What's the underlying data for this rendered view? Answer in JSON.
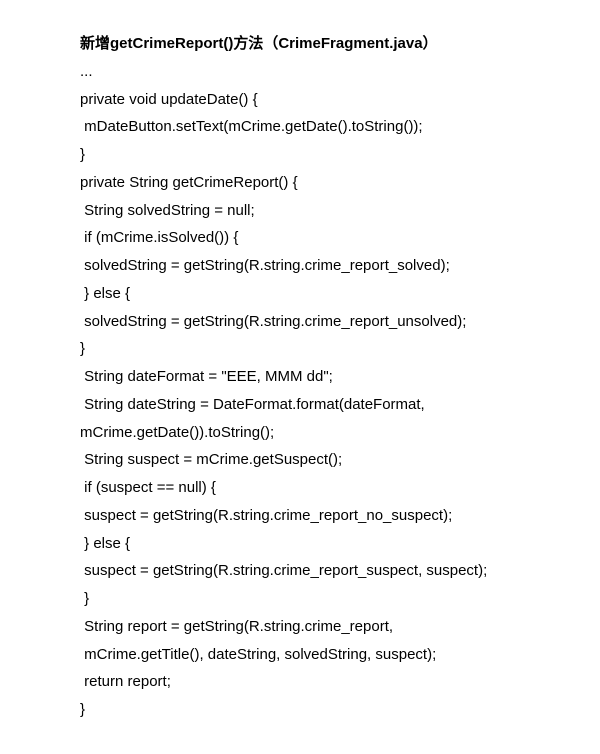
{
  "title": "新增getCrimeReport()方法（CrimeFragment.java）",
  "lines": [
    "...",
    "private void updateDate() {",
    " mDateButton.setText(mCrime.getDate().toString());",
    "}",
    "private String getCrimeReport() {",
    " String solvedString = null;",
    " if (mCrime.isSolved()) {",
    " solvedString = getString(R.string.crime_report_solved);",
    " } else {",
    " solvedString = getString(R.string.crime_report_unsolved);",
    "}",
    " String dateFormat = \"EEE, MMM dd\";",
    " String dateString = DateFormat.format(dateFormat,",
    "mCrime.getDate()).toString();",
    " String suspect = mCrime.getSuspect();",
    " if (suspect == null) {",
    " suspect = getString(R.string.crime_report_no_suspect);",
    " } else {",
    " suspect = getString(R.string.crime_report_suspect, suspect);",
    " }",
    " String report = getString(R.string.crime_report,",
    " mCrime.getTitle(), dateString, solvedString, suspect);",
    " return report;",
    "}"
  ]
}
